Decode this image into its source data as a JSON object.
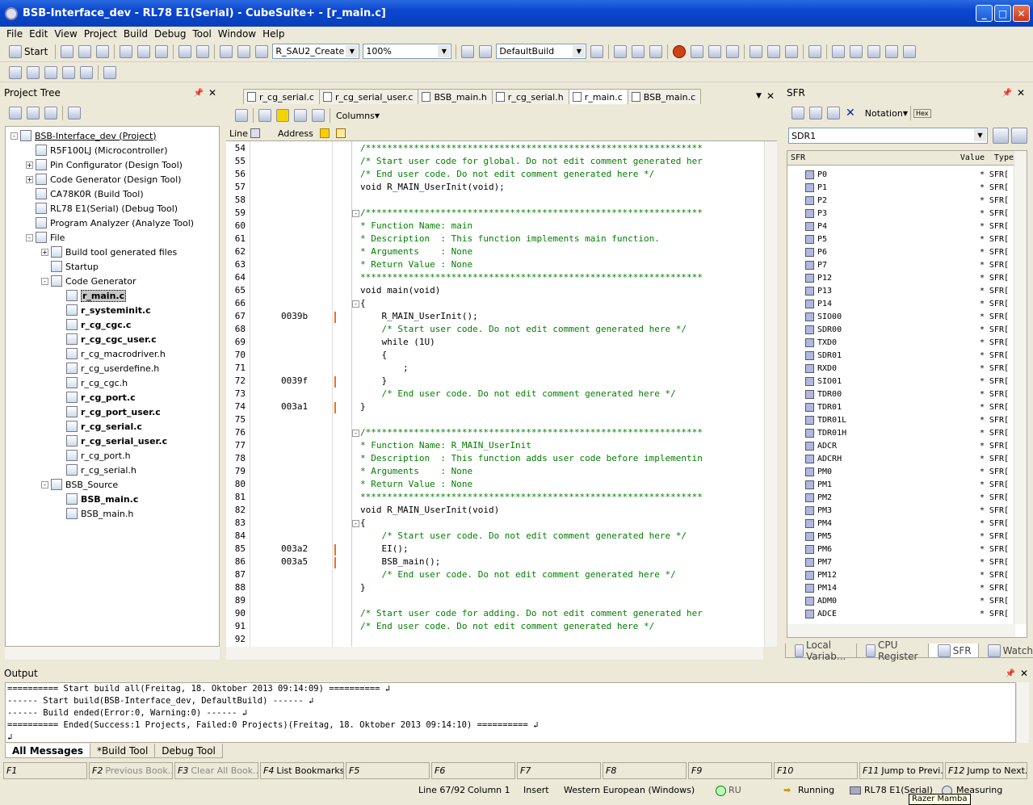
{
  "window": {
    "title": "BSB-Interface_dev - RL78 E1(Serial) - CubeSuite+ - [r_main.c]"
  },
  "menu": [
    "File",
    "Edit",
    "View",
    "Project",
    "Build",
    "Debug",
    "Tool",
    "Window",
    "Help"
  ],
  "toolbar": {
    "start": "Start",
    "component": "R_SAU2_Create",
    "zoom": "100%",
    "build_mode": "DefaultBuild"
  },
  "project_tree": {
    "title": "Project Tree",
    "items": [
      {
        "label": "BSB-Interface_dev (Project)",
        "indent": 0,
        "exp": "-",
        "style": "underline"
      },
      {
        "label": "R5F100LJ (Microcontroller)",
        "indent": 1,
        "exp": ""
      },
      {
        "label": "Pin Configurator (Design Tool)",
        "indent": 1,
        "exp": "+"
      },
      {
        "label": "Code Generator (Design Tool)",
        "indent": 1,
        "exp": "+"
      },
      {
        "label": "CA78K0R (Build Tool)",
        "indent": 1,
        "exp": ""
      },
      {
        "label": "RL78 E1(Serial) (Debug Tool)",
        "indent": 1,
        "exp": ""
      },
      {
        "label": "Program Analyzer (Analyze Tool)",
        "indent": 1,
        "exp": ""
      },
      {
        "label": "File",
        "indent": 1,
        "exp": "-"
      },
      {
        "label": "Build tool generated files",
        "indent": 2,
        "exp": "+"
      },
      {
        "label": "Startup",
        "indent": 2,
        "exp": ""
      },
      {
        "label": "Code Generator",
        "indent": 2,
        "exp": "-"
      },
      {
        "label": "r_main.c",
        "indent": 3,
        "exp": "",
        "style": "sel"
      },
      {
        "label": "r_systeminit.c",
        "indent": 3,
        "exp": "",
        "style": "bold"
      },
      {
        "label": "r_cg_cgc.c",
        "indent": 3,
        "exp": "",
        "style": "bold"
      },
      {
        "label": "r_cg_cgc_user.c",
        "indent": 3,
        "exp": "",
        "style": "bold"
      },
      {
        "label": "r_cg_macrodriver.h",
        "indent": 3,
        "exp": ""
      },
      {
        "label": "r_cg_userdefine.h",
        "indent": 3,
        "exp": ""
      },
      {
        "label": "r_cg_cgc.h",
        "indent": 3,
        "exp": ""
      },
      {
        "label": "r_cg_port.c",
        "indent": 3,
        "exp": "",
        "style": "bold"
      },
      {
        "label": "r_cg_port_user.c",
        "indent": 3,
        "exp": "",
        "style": "bold"
      },
      {
        "label": "r_cg_serial.c",
        "indent": 3,
        "exp": "",
        "style": "bold"
      },
      {
        "label": "r_cg_serial_user.c",
        "indent": 3,
        "exp": "",
        "style": "bold"
      },
      {
        "label": "r_cg_port.h",
        "indent": 3,
        "exp": ""
      },
      {
        "label": "r_cg_serial.h",
        "indent": 3,
        "exp": ""
      },
      {
        "label": "BSB_Source",
        "indent": 2,
        "exp": "-"
      },
      {
        "label": "BSB_main.c",
        "indent": 3,
        "exp": "",
        "style": "bold"
      },
      {
        "label": "BSB_main.h",
        "indent": 3,
        "exp": ""
      }
    ]
  },
  "editor": {
    "tabs": [
      "r_cg_serial.c",
      "r_cg_serial_user.c",
      "BSB_main.h",
      "r_cg_serial.h",
      "r_main.c",
      "BSB_main.c"
    ],
    "active_tab": "r_main.c",
    "columns_label": "Columns",
    "headers": {
      "line": "Line",
      "address": "Address"
    },
    "lines": [
      {
        "n": "54",
        "a": "",
        "m": false,
        "f": "",
        "c": "/***************************************************************",
        "t": "cm"
      },
      {
        "n": "55",
        "a": "",
        "m": false,
        "f": "",
        "c": "/* Start user code for global. Do not edit comment generated her",
        "t": "cm"
      },
      {
        "n": "56",
        "a": "",
        "m": false,
        "f": "",
        "c": "/* End user code. Do not edit comment generated here */",
        "t": "cm"
      },
      {
        "n": "57",
        "a": "",
        "m": false,
        "f": "",
        "c": "void R_MAIN_UserInit(void);",
        "t": "code"
      },
      {
        "n": "58",
        "a": "",
        "m": false,
        "f": "",
        "c": "",
        "t": "code"
      },
      {
        "n": "59",
        "a": "",
        "m": false,
        "f": "-",
        "c": "/***************************************************************",
        "t": "cm"
      },
      {
        "n": "60",
        "a": "",
        "m": false,
        "f": "",
        "c": "* Function Name: main",
        "t": "cm"
      },
      {
        "n": "61",
        "a": "",
        "m": false,
        "f": "",
        "c": "* Description  : This function implements main function.",
        "t": "cm"
      },
      {
        "n": "62",
        "a": "",
        "m": false,
        "f": "",
        "c": "* Arguments    : None",
        "t": "cm"
      },
      {
        "n": "63",
        "a": "",
        "m": false,
        "f": "",
        "c": "* Return Value : None",
        "t": "cm"
      },
      {
        "n": "64",
        "a": "",
        "m": false,
        "f": "",
        "c": "****************************************************************",
        "t": "cm"
      },
      {
        "n": "65",
        "a": "",
        "m": false,
        "f": "",
        "c": "void main(void)",
        "t": "code"
      },
      {
        "n": "66",
        "a": "",
        "m": false,
        "f": "-",
        "c": "{",
        "t": "code"
      },
      {
        "n": "67",
        "a": "0039b",
        "m": true,
        "f": "",
        "c": "    R_MAIN_UserInit();",
        "t": "code"
      },
      {
        "n": "68",
        "a": "",
        "m": false,
        "f": "",
        "c": "    /* Start user code. Do not edit comment generated here */",
        "t": "cm"
      },
      {
        "n": "69",
        "a": "",
        "m": false,
        "f": "",
        "c": "    while (1U)",
        "t": "code"
      },
      {
        "n": "70",
        "a": "",
        "m": false,
        "f": "",
        "c": "    {",
        "t": "code"
      },
      {
        "n": "71",
        "a": "",
        "m": false,
        "f": "",
        "c": "        ;",
        "t": "code"
      },
      {
        "n": "72",
        "a": "0039f",
        "m": true,
        "f": "",
        "c": "    }",
        "t": "code"
      },
      {
        "n": "73",
        "a": "",
        "m": false,
        "f": "",
        "c": "    /* End user code. Do not edit comment generated here */",
        "t": "cm"
      },
      {
        "n": "74",
        "a": "003a1",
        "m": true,
        "f": "",
        "c": "}",
        "t": "code"
      },
      {
        "n": "75",
        "a": "",
        "m": false,
        "f": "",
        "c": "",
        "t": "code"
      },
      {
        "n": "76",
        "a": "",
        "m": false,
        "f": "-",
        "c": "/***************************************************************",
        "t": "cm"
      },
      {
        "n": "77",
        "a": "",
        "m": false,
        "f": "",
        "c": "* Function Name: R_MAIN_UserInit",
        "t": "cm"
      },
      {
        "n": "78",
        "a": "",
        "m": false,
        "f": "",
        "c": "* Description  : This function adds user code before implementin",
        "t": "cm"
      },
      {
        "n": "79",
        "a": "",
        "m": false,
        "f": "",
        "c": "* Arguments    : None",
        "t": "cm"
      },
      {
        "n": "80",
        "a": "",
        "m": false,
        "f": "",
        "c": "* Return Value : None",
        "t": "cm"
      },
      {
        "n": "81",
        "a": "",
        "m": false,
        "f": "",
        "c": "****************************************************************",
        "t": "cm"
      },
      {
        "n": "82",
        "a": "",
        "m": false,
        "f": "",
        "c": "void R_MAIN_UserInit(void)",
        "t": "code"
      },
      {
        "n": "83",
        "a": "",
        "m": false,
        "f": "-",
        "c": "{",
        "t": "code"
      },
      {
        "n": "84",
        "a": "",
        "m": false,
        "f": "",
        "c": "    /* Start user code. Do not edit comment generated here */",
        "t": "cm"
      },
      {
        "n": "85",
        "a": "003a2",
        "m": true,
        "f": "",
        "c": "    EI();",
        "t": "code"
      },
      {
        "n": "86",
        "a": "003a5",
        "m": true,
        "f": "",
        "c": "    BSB_main();",
        "t": "code"
      },
      {
        "n": "87",
        "a": "",
        "m": false,
        "f": "",
        "c": "    /* End user code. Do not edit comment generated here */",
        "t": "cm"
      },
      {
        "n": "88",
        "a": "",
        "m": false,
        "f": "",
        "c": "}",
        "t": "code"
      },
      {
        "n": "89",
        "a": "",
        "m": false,
        "f": "",
        "c": "",
        "t": "code"
      },
      {
        "n": "90",
        "a": "",
        "m": false,
        "f": "",
        "c": "/* Start user code for adding. Do not edit comment generated her",
        "t": "cm"
      },
      {
        "n": "91",
        "a": "",
        "m": false,
        "f": "",
        "c": "/* End user code. Do not edit comment generated here */",
        "t": "cm"
      },
      {
        "n": "92",
        "a": "",
        "m": false,
        "f": "",
        "c": "",
        "t": "code"
      }
    ]
  },
  "sfr": {
    "title": "SFR",
    "notation": "Notation",
    "hex": "Hex",
    "selected": "SDR1",
    "headers": {
      "name": "SFR",
      "value": "Value",
      "type": "Type"
    },
    "rows": [
      "P0",
      "P1",
      "P2",
      "P3",
      "P4",
      "P5",
      "P6",
      "P7",
      "P12",
      "P13",
      "P14",
      "SIO00",
      "SDR00",
      "TXD0",
      "SDR01",
      "RXD0",
      "SIO01",
      "TDR00",
      "TDR01",
      "TDR01L",
      "TDR01H",
      "ADCR",
      "ADCRH",
      "PM0",
      "PM1",
      "PM2",
      "PM3",
      "PM4",
      "PM5",
      "PM6",
      "PM7",
      "PM12",
      "PM14",
      "ADM0",
      "ADCE"
    ],
    "value": "*",
    "type": "SFR[",
    "tabs": [
      "Local Variab...",
      "CPU Register",
      "SFR",
      "Watch1"
    ]
  },
  "output": {
    "title": "Output",
    "lines": [
      "========== Start build all(Freitag, 18. Oktober 2013 09:14:09) ==========",
      "------ Start build(BSB-Interface_dev, DefaultBuild) ------",
      "------ Build ended(Error:0, Warning:0) ------",
      "========== Ended(Success:1 Projects, Failed:0 Projects)(Freitag, 18. Oktober 2013 09:14:10) ==========",
      ""
    ],
    "tabs": [
      "All Messages",
      "*Build Tool",
      "Debug Tool"
    ]
  },
  "fkeys": [
    {
      "k": "F1",
      "l": ""
    },
    {
      "k": "F2",
      "l": "Previous Book..."
    },
    {
      "k": "F3",
      "l": "Clear All Book..."
    },
    {
      "k": "F4",
      "l": "List Bookmarks"
    },
    {
      "k": "F5",
      "l": ""
    },
    {
      "k": "F6",
      "l": ""
    },
    {
      "k": "F7",
      "l": ""
    },
    {
      "k": "F8",
      "l": ""
    },
    {
      "k": "F9",
      "l": ""
    },
    {
      "k": "F10",
      "l": ""
    },
    {
      "k": "F11",
      "l": "Jump to Previ..."
    },
    {
      "k": "F12",
      "l": "Jump to Next..."
    }
  ],
  "status": {
    "position": "Line 67/92",
    "column": "Column 1",
    "mode": "Insert",
    "encoding": "Western European (Windows)",
    "ru": "RU",
    "run": "Running",
    "tool": "RL78 E1(Serial)",
    "measure": "Measuring",
    "tooltip": "Razer Mamba"
  }
}
